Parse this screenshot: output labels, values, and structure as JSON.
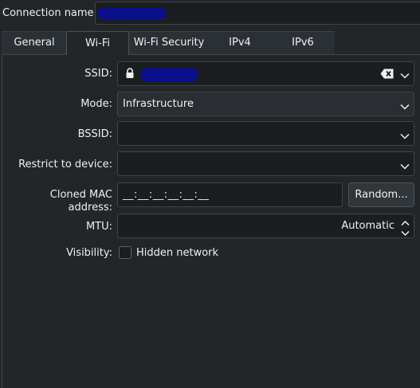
{
  "header": {
    "connection_name_label": "Connection name:",
    "connection_name_value": ""
  },
  "tabs": [
    {
      "label": "General",
      "active": false
    },
    {
      "label": "Wi-Fi",
      "active": true
    },
    {
      "label": "Wi-Fi Security",
      "active": false
    },
    {
      "label": "IPv4",
      "active": false
    },
    {
      "label": "IPv6",
      "active": false
    }
  ],
  "form": {
    "ssid": {
      "label": "SSID:",
      "value": "",
      "lock_icon": "lock-icon",
      "clear_icon": "backspace-clear-icon"
    },
    "mode": {
      "label": "Mode:",
      "value": "Infrastructure"
    },
    "bssid": {
      "label": "BSSID:",
      "value": ""
    },
    "restrict": {
      "label": "Restrict to device:",
      "value": ""
    },
    "cloned_mac": {
      "label": "Cloned MAC address:",
      "value": "__:__:__:__:__:__",
      "button": "Random..."
    },
    "mtu": {
      "label": "MTU:",
      "value": "Automatic"
    },
    "visibility": {
      "label": "Visibility:",
      "checkbox_label": "Hidden network",
      "checked": false
    }
  },
  "colors": {
    "background": "#232629",
    "field": "#1b1e20",
    "border": "#3f4449",
    "text": "#eff0f1",
    "redaction": "#0a0f8c"
  }
}
